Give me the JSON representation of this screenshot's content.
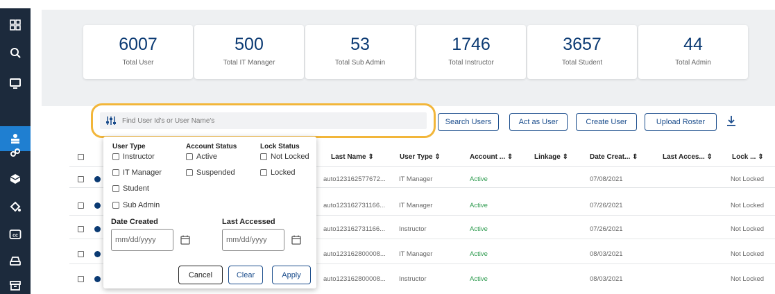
{
  "sidebar": {
    "icons": [
      "grid-icon",
      "search-icon",
      "monitor-icon",
      "users-icon",
      "link-icon",
      "cube-icon",
      "paint-bucket-icon",
      "closed-caption-icon",
      "drive-icon",
      "archive-icon"
    ]
  },
  "stats": [
    {
      "value": "6007",
      "label": "Total User"
    },
    {
      "value": "500",
      "label": "Total IT Manager"
    },
    {
      "value": "53",
      "label": "Total Sub Admin"
    },
    {
      "value": "1746",
      "label": "Total Instructor"
    },
    {
      "value": "3657",
      "label": "Total Student"
    },
    {
      "value": "44",
      "label": "Total Admin"
    }
  ],
  "search": {
    "placeholder": "Find User Id's or User Name's"
  },
  "toolbar": {
    "search_users": "Search Users",
    "act_as_user": "Act as User",
    "create_user": "Create User",
    "upload_roster": "Upload Roster"
  },
  "table": {
    "headers": {
      "last_name": "Last Name ⇕",
      "user_type": "User Type ⇕",
      "account": "Account ... ⇕",
      "linkage": "Linkage ⇕",
      "date_created": "Date Creat... ⇕",
      "last_access": "Last Acces... ⇕",
      "lock": "Lock ... ⇕"
    },
    "rows": [
      {
        "name": "auto123162577672...",
        "type": "IT Manager",
        "status": "Active",
        "date": "07/08/2021",
        "lock": "Not Locked"
      },
      {
        "name": "auto123162731166...",
        "type": "IT Manager",
        "status": "Active",
        "date": "07/26/2021",
        "lock": "Not Locked"
      },
      {
        "name": "auto123162731166...",
        "type": "Instructor",
        "status": "Active",
        "date": "07/26/2021",
        "lock": "Not Locked"
      },
      {
        "name": "auto123162800008...",
        "type": "IT Manager",
        "status": "Active",
        "date": "08/03/2021",
        "lock": "Not Locked"
      },
      {
        "name": "auto123162800008...",
        "type": "Instructor",
        "status": "Active",
        "date": "08/03/2021",
        "lock": "Not Locked"
      }
    ]
  },
  "filter": {
    "user_type_title": "User Type",
    "user_types": [
      "Instructor",
      "IT Manager",
      "Student",
      "Sub Admin"
    ],
    "account_status_title": "Account Status",
    "account_statuses": [
      "Active",
      "Suspended"
    ],
    "lock_status_title": "Lock Status",
    "lock_statuses": [
      "Not Locked",
      "Locked"
    ],
    "date_created_title": "Date Created",
    "last_accessed_title": "Last Accessed",
    "date_placeholder": "mm/dd/yyyy",
    "cancel": "Cancel",
    "clear": "Clear",
    "apply": "Apply"
  },
  "colors": {
    "sidebar": "#1c2a3c",
    "accent": "#1f7fd1",
    "primary": "#1b4d8c",
    "highlight": "#f2b63a",
    "active": "#2e9b4f"
  }
}
